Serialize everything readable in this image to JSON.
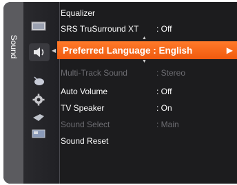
{
  "tab_label": "Sound",
  "menu": {
    "equalizer": {
      "label": "Equalizer"
    },
    "srs": {
      "label": "SRS TruSurround XT",
      "value": ": Off"
    },
    "preferred_language": {
      "label": "Preferred Language : English"
    },
    "multi_track": {
      "label": "Multi-Track Sound",
      "value": ": Stereo"
    },
    "auto_volume": {
      "label": "Auto Volume",
      "value": ": Off"
    },
    "tv_speaker": {
      "label": "TV Speaker",
      "value": ": On"
    },
    "sound_select": {
      "label": "Sound Select",
      "value": ": Main"
    },
    "sound_reset": {
      "label": "Sound Reset"
    }
  },
  "arrows": {
    "right": "▶",
    "up": "▲",
    "down": "▼",
    "left": "◀"
  },
  "colors": {
    "highlight": "#f05a0e",
    "panel": "#1c1c1e",
    "disabled_text": "#6d6d72"
  },
  "icons": [
    "picture-icon",
    "sound-icon",
    "channel-icon",
    "setup-icon",
    "input-icon",
    "application-icon"
  ]
}
